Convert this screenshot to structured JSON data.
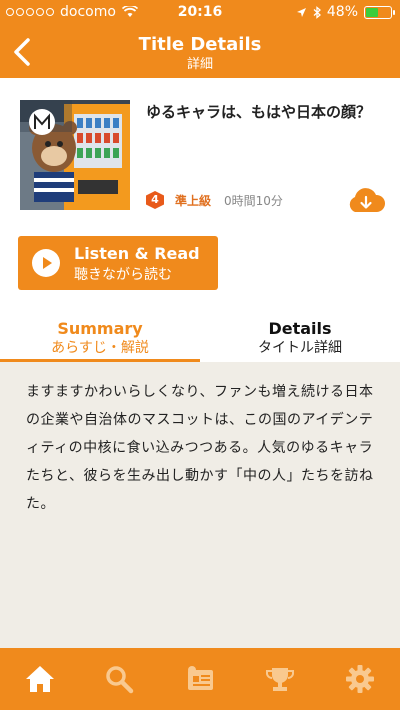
{
  "status_bar": {
    "carrier": "docomo",
    "time": "20:16",
    "battery": "48%"
  },
  "nav": {
    "title": "Title Details",
    "subtitle": "詳細"
  },
  "book": {
    "title": "ゆるキャラは、もはや日本の顔？",
    "level_number": "4",
    "level_label": "準上級",
    "duration": "0時間10分"
  },
  "listen_button": {
    "label_en": "Listen & Read",
    "label_ja": "聴きながら読む"
  },
  "tabs": [
    {
      "label_en": "Summary",
      "label_ja": "あらすじ・解説",
      "active": true
    },
    {
      "label_en": "Details",
      "label_ja": "タイトル詳細",
      "active": false
    }
  ],
  "summary": "ますますかわいらしくなり、ファンも増え続ける日本の企業や自治体のマスコットは、この国のアイデンティティの中核に食い込みつつある。人気のゆるキャラたちと、彼らを生み出し動かす「中の人」たちを訪ねた。",
  "tab_bar": {
    "items": [
      "home-icon",
      "search-icon",
      "news-icon",
      "trophy-icon",
      "settings-icon"
    ]
  },
  "colors": {
    "accent": "#f08a1c",
    "level_badge": "#e85a1a",
    "background": "#f0ede6"
  }
}
